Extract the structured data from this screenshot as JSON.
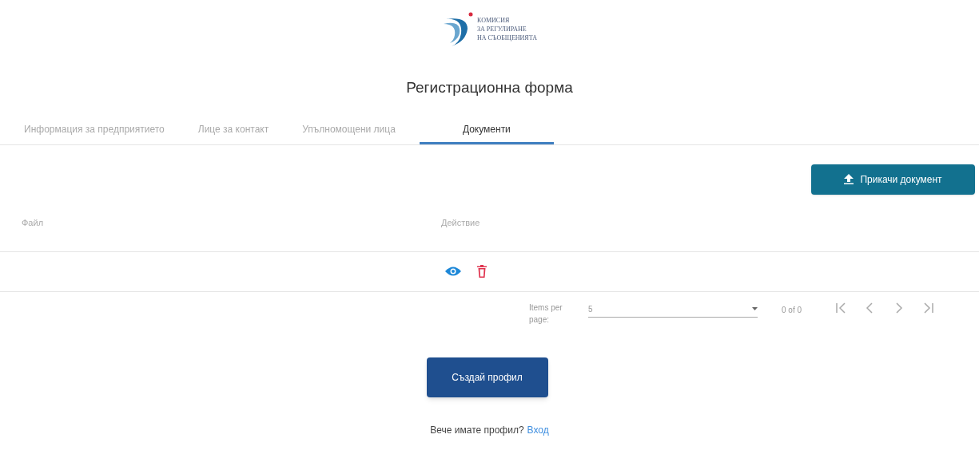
{
  "logo": {
    "lines": [
      "КОМИСИЯ",
      "ЗА РЕГУЛИРАНЕ",
      "НА СЪОБЩЕНИЯТА"
    ]
  },
  "title": "Регистрационна форма",
  "tabs": [
    {
      "label": "Информация за предприятието",
      "selected": false
    },
    {
      "label": "Лице за контакт",
      "selected": false
    },
    {
      "label": "Упълномощени лица",
      "selected": false
    },
    {
      "label": "Документи",
      "selected": true
    }
  ],
  "upload_button": "Прикачи документ",
  "table": {
    "columns": [
      "Файл",
      "Действие"
    ]
  },
  "paginator": {
    "label": "Items per page:",
    "page_size": "5",
    "range": "0 of 0"
  },
  "submit_button": "Създай профил",
  "footer": {
    "text": "Вече имате профил?",
    "link": "Вход"
  }
}
